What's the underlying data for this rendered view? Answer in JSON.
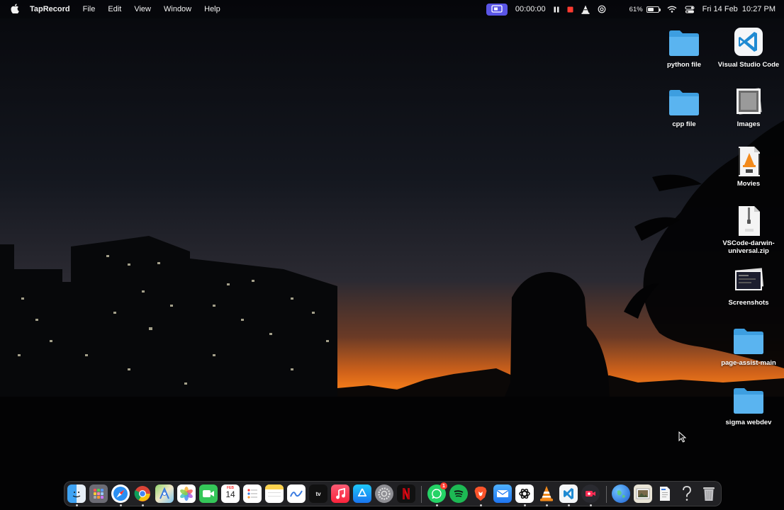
{
  "menubar": {
    "app_name": "TapRecord",
    "menus": [
      "File",
      "Edit",
      "View",
      "Window",
      "Help"
    ],
    "timer": "00:00:00",
    "battery_percent": "61%",
    "battery_level": 0.61,
    "datetime": "Fri 14 Feb  10:27 PM",
    "icons": [
      "apple-icon",
      "screen-record-icon",
      "pause-icon",
      "stop-icon",
      "vlc-cone-icon",
      "chatgpt-icon",
      "moon-icon",
      "battery-icon",
      "wifi-icon",
      "control-center-icon"
    ]
  },
  "desktop": {
    "icons": [
      {
        "label": "python file",
        "type": "folder"
      },
      {
        "label": "Visual Studio Code",
        "type": "vscode"
      },
      {
        "label": "cpp file",
        "type": "folder"
      },
      {
        "label": "Images",
        "type": "image-stack"
      },
      {
        "label": "Movies",
        "type": "mkv"
      },
      {
        "label": "VSCode-darwin-universal.zip",
        "type": "zip"
      },
      {
        "label": "Screenshots",
        "type": "screenshot-stack"
      },
      {
        "label": "page-assist-main",
        "type": "folder"
      },
      {
        "label": "sigma webdev",
        "type": "folder"
      }
    ]
  },
  "dock": {
    "calendar_month": "FEB",
    "calendar_day": "14",
    "appletv_label": "tv",
    "whatsapp_badge": "1",
    "apps": [
      "Finder",
      "Launchpad",
      "Safari",
      "Chrome",
      "Maps",
      "Photos",
      "FaceTime",
      "Calendar",
      "Reminders",
      "Notes",
      "Freeform",
      "Apple TV",
      "Music",
      "App Store",
      "System Settings",
      "Netflix",
      "WhatsApp",
      "Spotify",
      "Brave",
      "Mail",
      "ChatGPT",
      "VLC",
      "VS Code",
      "TapRecord",
      "Globe",
      "Preview",
      "Document",
      "Help",
      "Trash"
    ]
  },
  "colors": {
    "folder_blue": "#5ab4f0",
    "record_purple": "#5a55e6",
    "record_red": "#ff3b30"
  }
}
